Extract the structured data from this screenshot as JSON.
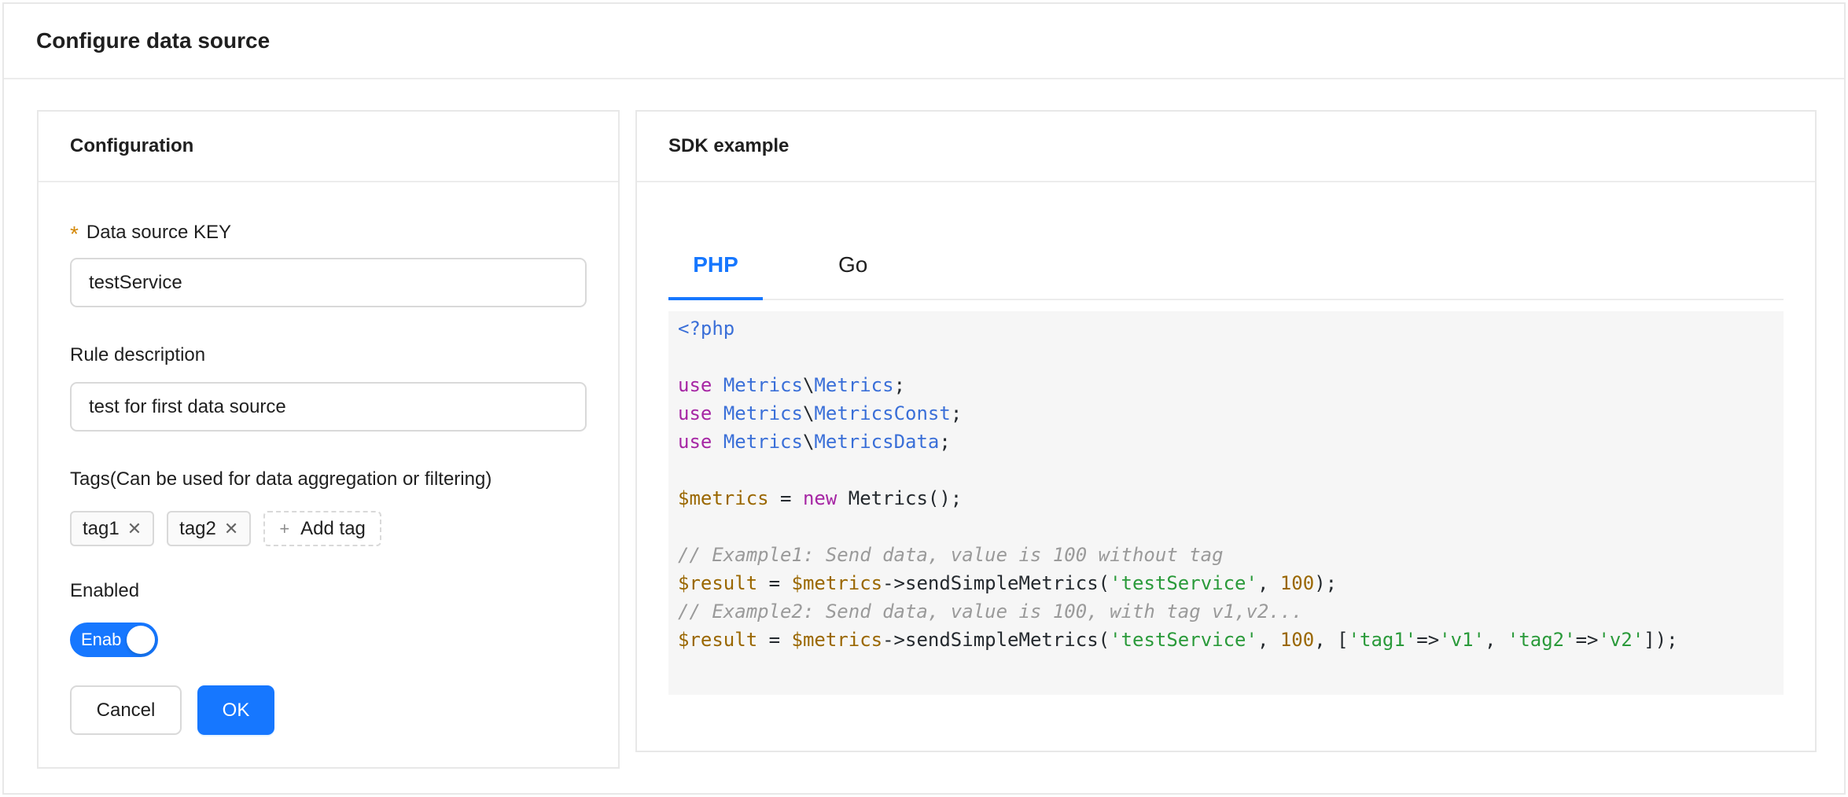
{
  "modal": {
    "title": "Configure data source"
  },
  "config": {
    "title": "Configuration",
    "key_label": "Data source KEY",
    "key_required_mark": "*",
    "key_value": "testService",
    "desc_label": "Rule description",
    "desc_value": "test for first data source",
    "tags_label": "Tags(Can be used for data aggregation or filtering)",
    "tags": [
      "tag1",
      "tag2"
    ],
    "tag_close": "✕",
    "add_tag_plus": "+",
    "add_tag_label": "Add tag",
    "enabled_label": "Enabled",
    "switch_text": "Enab",
    "switch_on": true,
    "cancel_label": "Cancel",
    "ok_label": "OK"
  },
  "sdk": {
    "title": "SDK example",
    "tabs": [
      "PHP",
      "Go"
    ],
    "active_tab": "PHP",
    "code": {
      "l1": "<?php",
      "use": "use",
      "ns": "Metrics",
      "sep": "\\",
      "cls1": "Metrics",
      "cls2": "MetricsConst",
      "cls3": "MetricsData",
      "semi": ";",
      "var_metrics": "$metrics",
      "assign": " = ",
      "new": "new",
      "ctor": " Metrics();",
      "comment1": "// Example1: Send data, value is 100 without tag",
      "comment2": "// Example2: Send data, value is 100, with tag v1,v2...",
      "var_result": "$result",
      "arrow_call": "->sendSimpleMetrics(",
      "str_service": "'testService'",
      "comma": ", ",
      "num100": "100",
      "end1": ");",
      "bracket_open": "[",
      "str_tag1": "'tag1'",
      "fat_arrow": "=>",
      "str_v1": "'v1'",
      "str_tag2": "'tag2'",
      "str_v2": "'v2'",
      "end2": "]);"
    }
  },
  "colors": {
    "primary": "#1677ff",
    "required": "#d48806",
    "code_bg": "#f6f6f6"
  }
}
